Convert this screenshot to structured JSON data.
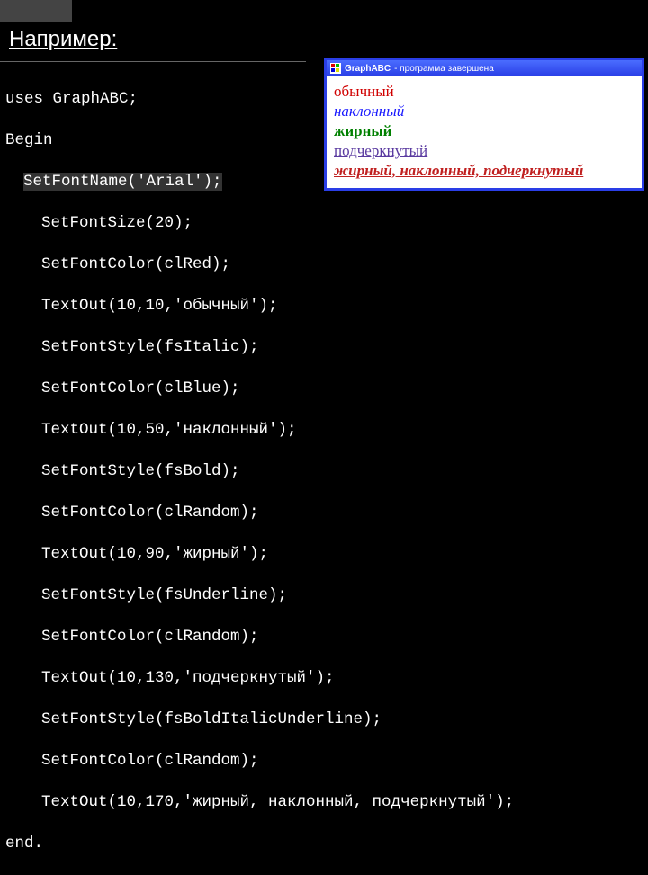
{
  "heading": "Например:",
  "code": {
    "l01": "uses GraphABC;",
    "l02": "Begin",
    "l03": "SetFontName('Arial');",
    "l04": "SetFontSize(20);",
    "l05": "SetFontColor(clRed);",
    "l06": "TextOut(10,10,'обычный');",
    "l07": "SetFontStyle(fsItalic);",
    "l08": "SetFontColor(clBlue);",
    "l09": "TextOut(10,50,'наклонный');",
    "l10": "SetFontStyle(fsBold);",
    "l11": "SetFontColor(clRandom);",
    "l12": "TextOut(10,90,'жирный');",
    "l13": "SetFontStyle(fsUnderline);",
    "l14": "SetFontColor(clRandom);",
    "l15": "TextOut(10,130,'подчеркнутый');",
    "l16": "SetFontStyle(fsBoldItalicUnderline);",
    "l17": "SetFontColor(clRandom);",
    "l18": "TextOut(10,170,'жирный, наклонный, подчеркнутый');",
    "l19": "end."
  },
  "output": {
    "title_app": "GraphABC",
    "title_status": "- программа завершена",
    "rows": {
      "r1": "обычный",
      "r2": "наклонный",
      "r3": "жирный",
      "r4": "подчеркнутый",
      "r5": "жирный, наклонный, подчеркнутый"
    }
  }
}
